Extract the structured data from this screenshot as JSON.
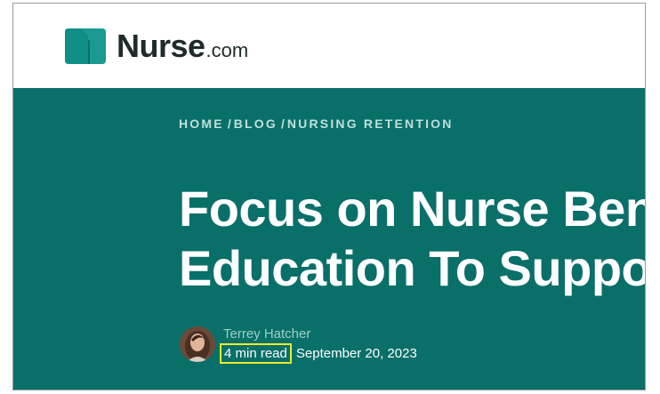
{
  "header": {
    "logo_word": "Nurse",
    "logo_tld": ".com",
    "logo_colors": {
      "left": "#0f8f86",
      "right": "#1a9a90",
      "text": "#1f2a2a"
    }
  },
  "breadcrumb": {
    "items": [
      {
        "label": "HOME"
      },
      {
        "label": "BLOG"
      },
      {
        "label": "NURSING RETENTION"
      }
    ],
    "separator": "/"
  },
  "article": {
    "title_line_1": "Focus on Nurse Bene",
    "title_line_2": "Education To Suppor",
    "author": "Terrey Hatcher",
    "read_time": "4 min read",
    "date": "September 20, 2023"
  },
  "colors": {
    "hero_bg": "#096f69",
    "highlight": "#e8ee2b"
  }
}
